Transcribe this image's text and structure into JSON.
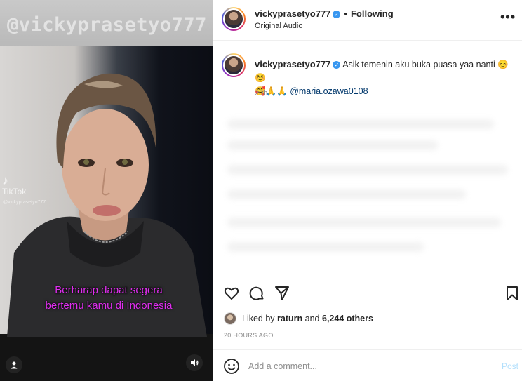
{
  "media": {
    "watermark": "@vickyprasetyo777",
    "tiktok_label": "TikTok",
    "tiktok_handle": "@vickyprasetyo777",
    "caption_line1": "Berharap dapat segera",
    "caption_line2": "bertemu kamu di Indonesia",
    "caption_color": "#e02ef0"
  },
  "header": {
    "username": "vickyprasetyo777",
    "separator": "•",
    "follow_status": "Following",
    "audio": "Original Audio",
    "more_label": "•••"
  },
  "post_comment": {
    "username": "vickyprasetyo777",
    "text": "Asik temenin aku buka puasa yaa nanti ☺️☺️",
    "emojis": "🥰🙏🙏",
    "mention": "@maria.ozawa0108",
    "time": "20h"
  },
  "likes": {
    "prefix": "Liked by",
    "user": "raturn",
    "conjunction": "and",
    "others": "6,244 others"
  },
  "timestamp": "20 HOURS AGO",
  "comment_box": {
    "placeholder": "Add a comment...",
    "post_label": "Post"
  },
  "icons": {
    "like": "heart-icon",
    "comment": "comment-icon",
    "share": "share-icon",
    "save": "bookmark-icon",
    "emoji": "emoji-icon",
    "user_tag": "user-icon",
    "mute": "speaker-icon"
  },
  "colors": {
    "verified": "#3897f0",
    "mention": "#00376b",
    "post_button": "#b2dffc",
    "muted_text": "#8e8e8e"
  }
}
